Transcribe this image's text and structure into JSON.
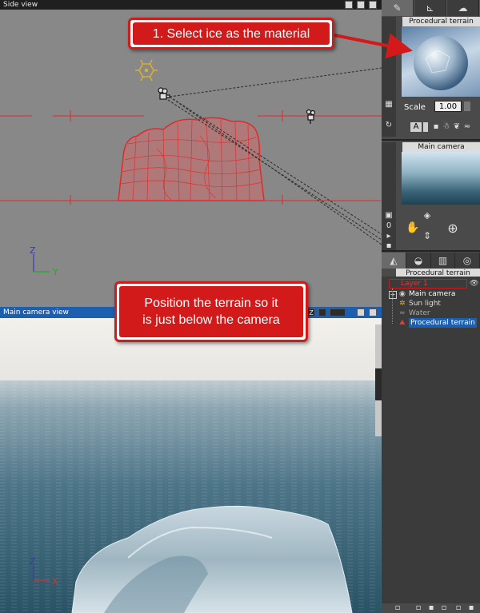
{
  "side_view": {
    "title": "Side view",
    "axis_z": "Z",
    "axis_y": "Y"
  },
  "camera_view": {
    "title": "Main camera view",
    "toolbar_icons": [
      "zoom-icon",
      "magnify-icon",
      "pan-icon",
      "settings-icon",
      "maximize-icon"
    ],
    "axis_z": "Z",
    "axis_x": "X"
  },
  "material_panel": {
    "tabs": [
      "brush-icon",
      "terrain-icon",
      "clouds-icon"
    ],
    "title": "Procedural terrain",
    "scale_label": "Scale",
    "scale_value": "1.00",
    "mode_label": "A"
  },
  "camera_panel": {
    "title": "Main camera",
    "counter": "0"
  },
  "scene_panel": {
    "tabs": [
      "objects-icon",
      "lights-icon",
      "film-icon",
      "layers-icon"
    ],
    "title": "Procedural terrain",
    "tree": [
      {
        "label": "Layer 1",
        "selected": false,
        "header": true
      },
      {
        "label": "Main camera",
        "selected": false
      },
      {
        "label": "Sun light",
        "selected": false
      },
      {
        "label": "Water",
        "selected": false
      },
      {
        "label": "Procedural terrain",
        "selected": true
      }
    ]
  },
  "annotations": {
    "material_tip": "1. Select ice as the material",
    "position_tip_line1": "Position the terrain so it",
    "position_tip_line2": "is just below the camera"
  },
  "colors": {
    "callout_red": "#d21a1a",
    "selection_blue": "#1c5fb0",
    "wireframe_red": "#e02a2a",
    "viewport_gray": "#888888"
  }
}
